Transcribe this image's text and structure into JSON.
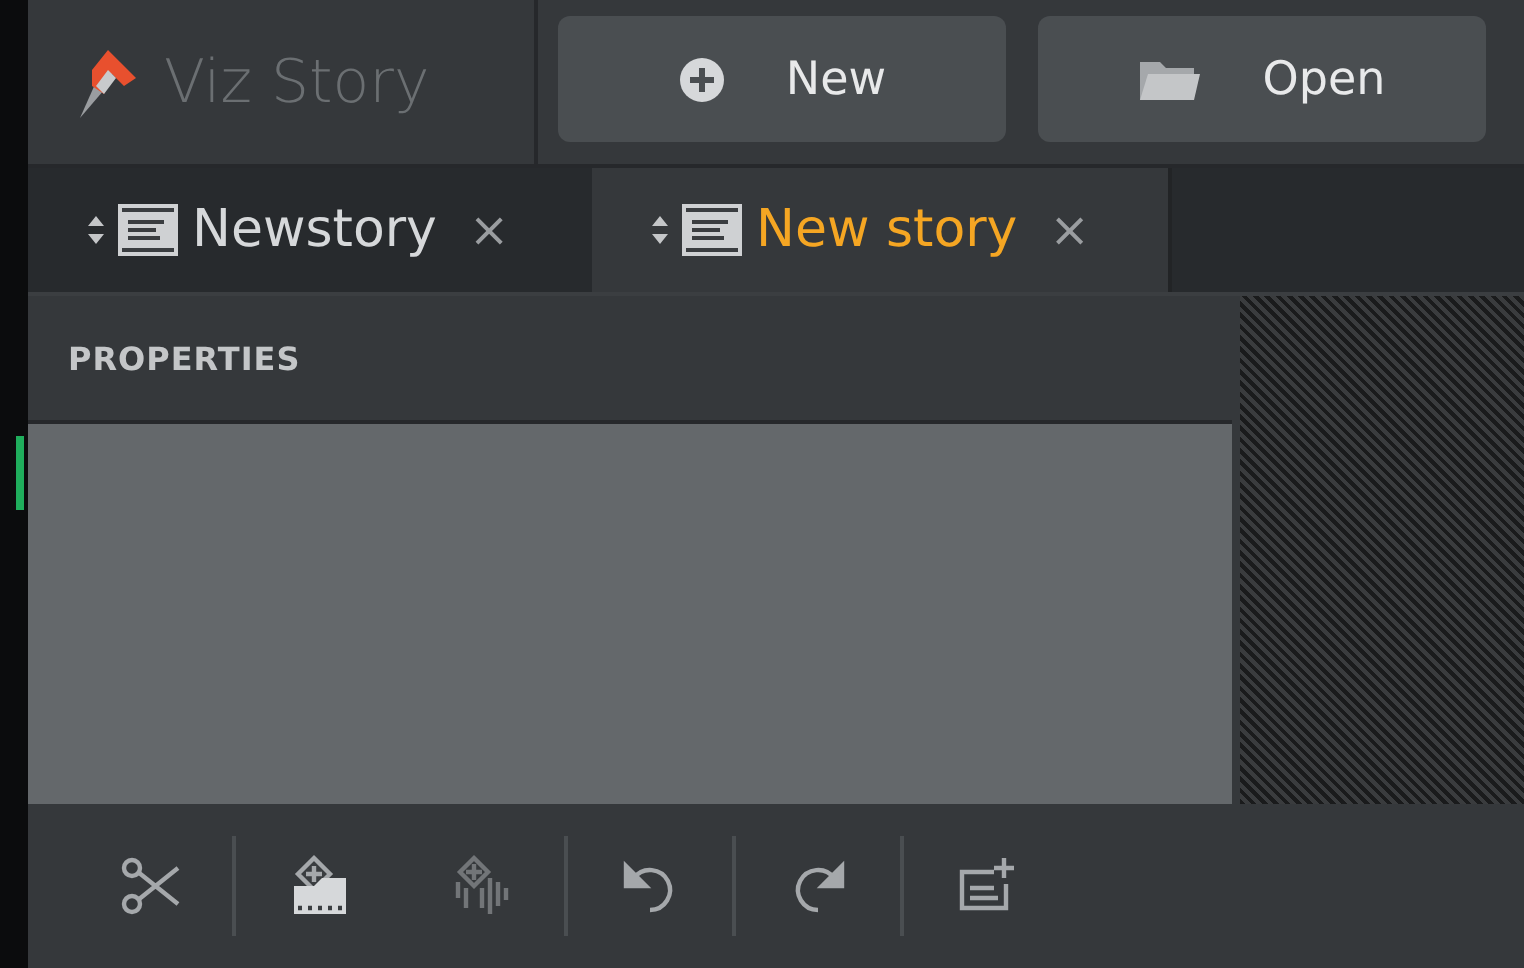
{
  "app": {
    "title": "Viz Story"
  },
  "header_buttons": [
    {
      "kind": "new",
      "label": "New"
    },
    {
      "kind": "open",
      "label": "Open"
    }
  ],
  "tabs": [
    {
      "label": "Newstory",
      "selected": false,
      "close": "×"
    },
    {
      "label": "New story",
      "selected": true,
      "close": "×"
    }
  ],
  "panel": {
    "title": "PROPERTIES"
  },
  "toolbar": [
    {
      "kind": "cut",
      "disabled": false
    },
    {
      "kind": "separator"
    },
    {
      "kind": "add-video",
      "disabled": false
    },
    {
      "kind": "add-audio",
      "disabled": true
    },
    {
      "kind": "separator"
    },
    {
      "kind": "undo",
      "disabled": false
    },
    {
      "kind": "separator"
    },
    {
      "kind": "redo",
      "disabled": false
    },
    {
      "kind": "separator"
    },
    {
      "kind": "add-text",
      "disabled": false
    }
  ]
}
